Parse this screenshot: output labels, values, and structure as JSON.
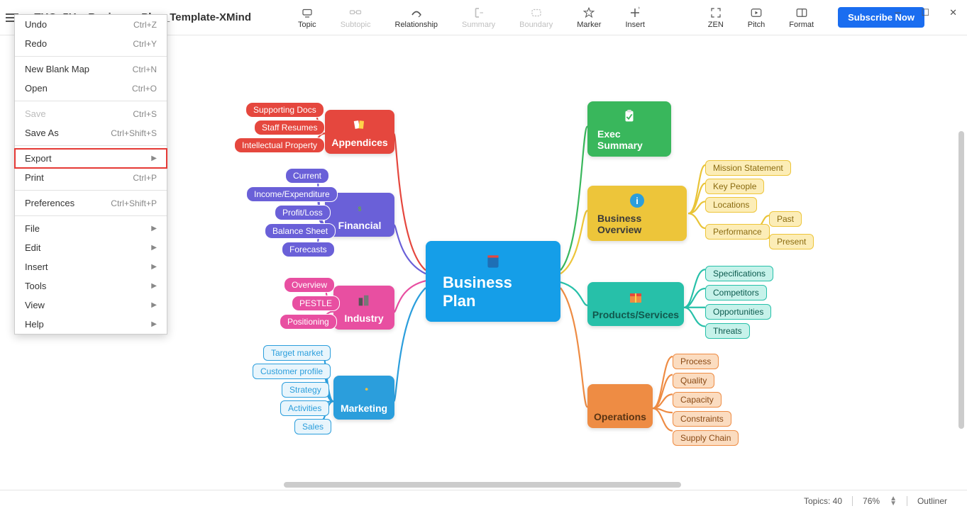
{
  "window": {
    "title": "cTUQy5Uc_Business_Plan_Template-XMind"
  },
  "toolbar": {
    "items": [
      {
        "label": "Topic",
        "enabled": true
      },
      {
        "label": "Subtopic",
        "enabled": false
      },
      {
        "label": "Relationship",
        "enabled": true
      },
      {
        "label": "Summary",
        "enabled": false
      },
      {
        "label": "Boundary",
        "enabled": false
      },
      {
        "label": "Marker",
        "enabled": true
      },
      {
        "label": "Insert",
        "enabled": true
      }
    ],
    "right": [
      {
        "label": "ZEN"
      },
      {
        "label": "Pitch"
      },
      {
        "label": "Format"
      }
    ],
    "subscribe": "Subscribe Now"
  },
  "filemenu": [
    {
      "label": "Undo",
      "shortcut": "Ctrl+Z"
    },
    {
      "label": "Redo",
      "shortcut": "Ctrl+Y"
    },
    {
      "sep": true
    },
    {
      "label": "New Blank Map",
      "shortcut": "Ctrl+N"
    },
    {
      "label": "Open",
      "shortcut": "Ctrl+O"
    },
    {
      "sep": true
    },
    {
      "label": "Save",
      "shortcut": "Ctrl+S",
      "disabled": true
    },
    {
      "label": "Save As",
      "shortcut": "Ctrl+Shift+S"
    },
    {
      "sep": true
    },
    {
      "label": "Export",
      "sub": true,
      "hl": true
    },
    {
      "label": "Print",
      "shortcut": "Ctrl+P"
    },
    {
      "sep": true
    },
    {
      "label": "Preferences",
      "shortcut": "Ctrl+Shift+P"
    },
    {
      "sep": true
    },
    {
      "label": "File",
      "sub": true
    },
    {
      "label": "Edit",
      "sub": true
    },
    {
      "label": "Insert",
      "sub": true
    },
    {
      "label": "Tools",
      "sub": true
    },
    {
      "label": "View",
      "sub": true
    },
    {
      "label": "Help",
      "sub": true
    }
  ],
  "mindmap": {
    "central": "Business Plan",
    "branches": {
      "appendices": {
        "label": "Appendices",
        "color": "#e5473e",
        "children": [
          "Supporting Docs",
          "Staff Resumes",
          "Intellectual Property"
        ]
      },
      "financial": {
        "label": "Financial",
        "color": "#6a60d8",
        "children": [
          "Current",
          "Income/Expenditure",
          "Profit/Loss",
          "Balance Sheet",
          "Forecasts"
        ]
      },
      "industry": {
        "label": "Industry",
        "color": "#e84fa1",
        "children": [
          "Overview",
          "PESTLE",
          "Positioning"
        ]
      },
      "marketing": {
        "label": "Marketing",
        "color": "#2b9edc",
        "children": [
          "Target market",
          "Customer profile",
          "Strategy",
          "Activities",
          "Sales"
        ]
      },
      "exec": {
        "label": "Exec Summary",
        "color": "#39b75c"
      },
      "overview": {
        "label": "Business Overview",
        "color": "#edc53a",
        "children": [
          "Mission Statement",
          "Key People",
          "Locations",
          "Performance"
        ],
        "perf": [
          "Past",
          "Present"
        ]
      },
      "products": {
        "label": "Products/Services",
        "color": "#27c0a9",
        "children": [
          "Specifications",
          "Competitors",
          "Opportunities",
          "Threats"
        ]
      },
      "operations": {
        "label": "Operations",
        "color": "#ee8c44",
        "children": [
          "Process",
          "Quality",
          "Capacity",
          "Constraints",
          "Supply Chain"
        ]
      }
    }
  },
  "status": {
    "topics_label": "Topics:",
    "topics_count": "40",
    "zoom": "76%",
    "outliner": "Outliner"
  }
}
